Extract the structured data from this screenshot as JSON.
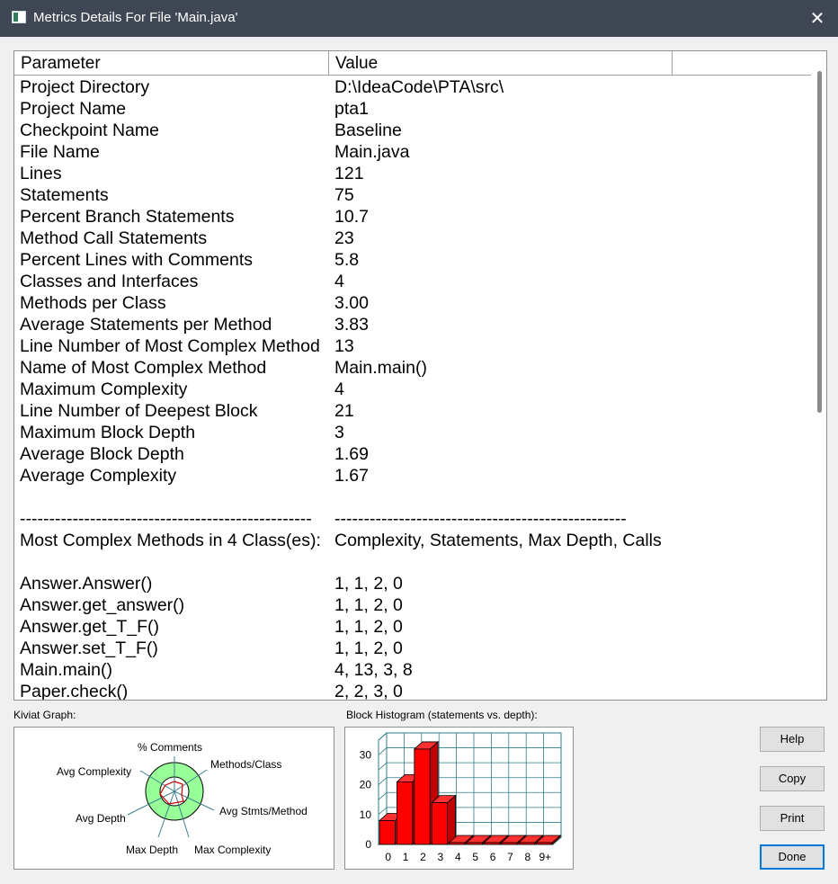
{
  "window": {
    "title": "Metrics Details For File 'Main.java'",
    "close_glyph": "✕"
  },
  "table": {
    "headers": [
      "Parameter",
      "Value"
    ],
    "rows": [
      [
        "Project Directory",
        "D:\\IdeaCode\\PTA\\src\\"
      ],
      [
        "Project Name",
        "pta1"
      ],
      [
        "Checkpoint Name",
        "Baseline"
      ],
      [
        "File Name",
        "Main.java"
      ],
      [
        "Lines",
        "121"
      ],
      [
        "Statements",
        "75"
      ],
      [
        "Percent Branch Statements",
        "10.7"
      ],
      [
        "Method Call Statements",
        "23"
      ],
      [
        "Percent Lines with Comments",
        "5.8"
      ],
      [
        "Classes and Interfaces",
        "4"
      ],
      [
        "Methods per Class",
        "3.00"
      ],
      [
        "Average Statements per Method",
        "3.83"
      ],
      [
        "Line Number of Most Complex Method",
        "13"
      ],
      [
        "Name of Most Complex Method",
        "Main.main()"
      ],
      [
        "Maximum Complexity",
        "4"
      ],
      [
        "Line Number of Deepest Block",
        "21"
      ],
      [
        "Maximum Block Depth",
        "3"
      ],
      [
        "Average Block Depth",
        "1.69"
      ],
      [
        "Average Complexity",
        "1.67"
      ],
      [
        "",
        ""
      ],
      [
        "--------------------------------------------------",
        "--------------------------------------------------"
      ],
      [
        "Most Complex Methods in 4 Class(es):",
        "Complexity, Statements, Max Depth, Calls"
      ],
      [
        "",
        ""
      ],
      [
        "Answer.Answer()",
        "1, 1, 2, 0"
      ],
      [
        "Answer.get_answer()",
        "1, 1, 2, 0"
      ],
      [
        "Answer.get_T_F()",
        "1, 1, 2, 0"
      ],
      [
        "Answer.set_T_F()",
        "1, 1, 2, 0"
      ],
      [
        "Main.main()",
        "4, 13, 3, 8"
      ],
      [
        "Paper.check()",
        "2, 2, 3, 0"
      ]
    ]
  },
  "kiviat": {
    "label": "Kiviat Graph:",
    "axes": [
      "% Comments",
      "Methods/Class",
      "Avg Stmts/Method",
      "Max Complexity",
      "Max Depth",
      "Avg Depth",
      "Avg Complexity"
    ],
    "colors": {
      "outer": "#99ff99",
      "inner": "#ffffff",
      "polygon": "#cc0000",
      "ring": "#000000",
      "spoke": "#3a7f8c"
    }
  },
  "histogram": {
    "label": "Block Histogram (statements vs. depth):",
    "colors": {
      "bar": "#ff0000",
      "grid": "#2e7d89"
    }
  },
  "chart_data": {
    "type": "bar",
    "categories": [
      "0",
      "1",
      "2",
      "3",
      "4",
      "5",
      "6",
      "7",
      "8",
      "9+"
    ],
    "values": [
      8,
      21,
      32,
      14,
      0,
      0,
      0,
      0,
      0,
      0
    ],
    "ylim": [
      0,
      35
    ],
    "yticks": [
      "0",
      "10",
      "20",
      "30"
    ],
    "grid": true
  },
  "buttons": {
    "help": "Help",
    "copy": "Copy",
    "print": "Print",
    "done": "Done"
  }
}
